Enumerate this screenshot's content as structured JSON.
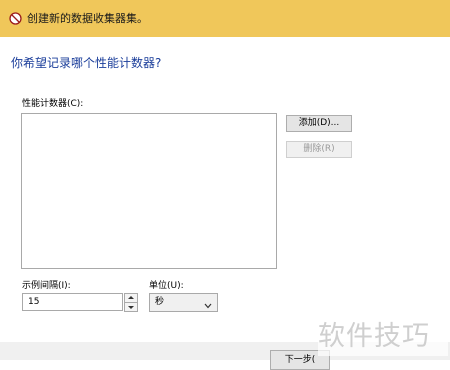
{
  "window": {
    "title": "创建新的数据收集器集。"
  },
  "heading": "你希望记录哪个性能计数器?",
  "counters": {
    "label": "性能计数器(C):",
    "items": []
  },
  "buttons": {
    "add": "添加(D)...",
    "remove": "删除(R)",
    "next": "下一步("
  },
  "sample_interval": {
    "label": "示例间隔(I):",
    "value": "15"
  },
  "units": {
    "label": "单位(U):",
    "selected": "秒"
  },
  "watermark": "软件技巧",
  "colors": {
    "titlebar": "#f0c75a",
    "heading": "#1a3d9a"
  }
}
